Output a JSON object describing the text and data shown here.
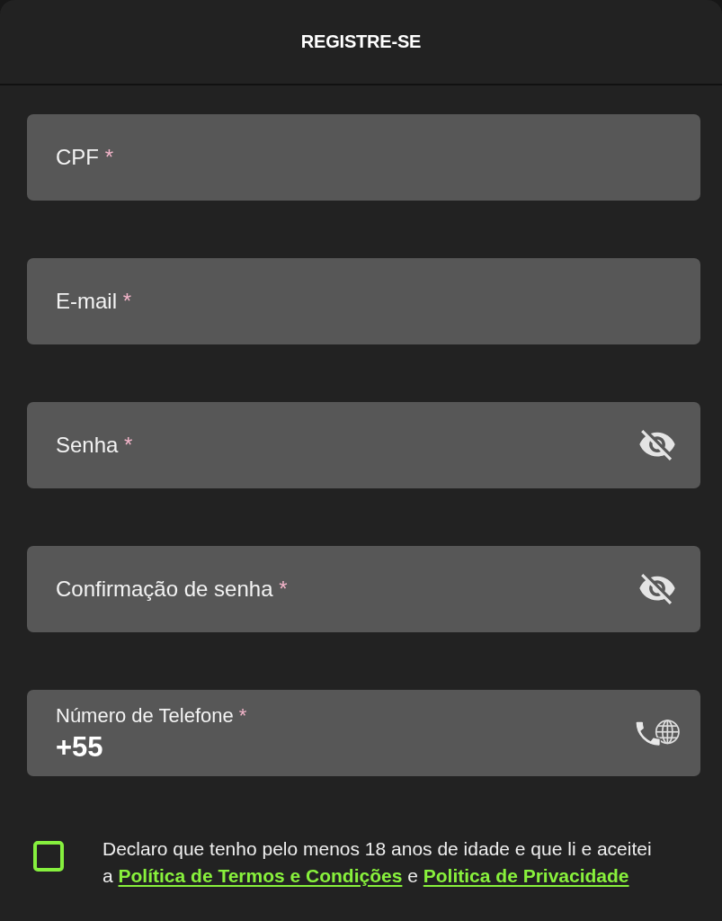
{
  "header": {
    "title": "REGISTRE-SE"
  },
  "fields": [
    {
      "kind": "text",
      "label": "CPF",
      "required_mark": "*"
    },
    {
      "kind": "text",
      "label": "E-mail",
      "required_mark": "*"
    },
    {
      "kind": "password",
      "label": "Senha",
      "required_mark": "*",
      "revealed": false
    },
    {
      "kind": "password",
      "label": "Confirmação de senha",
      "required_mark": "*",
      "revealed": false
    },
    {
      "kind": "phone",
      "label": "Número de Telefone",
      "required_mark": "*",
      "value": "+55"
    }
  ],
  "consent": {
    "checked": false,
    "segments": [
      {
        "kind": "text",
        "text": "Declaro que tenho pelo menos 18 anos de idade e que li e aceitei a"
      },
      {
        "kind": "link",
        "text": "Política de Termos e Condições"
      },
      {
        "kind": "text",
        "text": "e"
      },
      {
        "kind": "link",
        "text": "Politica de Privacidade"
      }
    ]
  }
}
